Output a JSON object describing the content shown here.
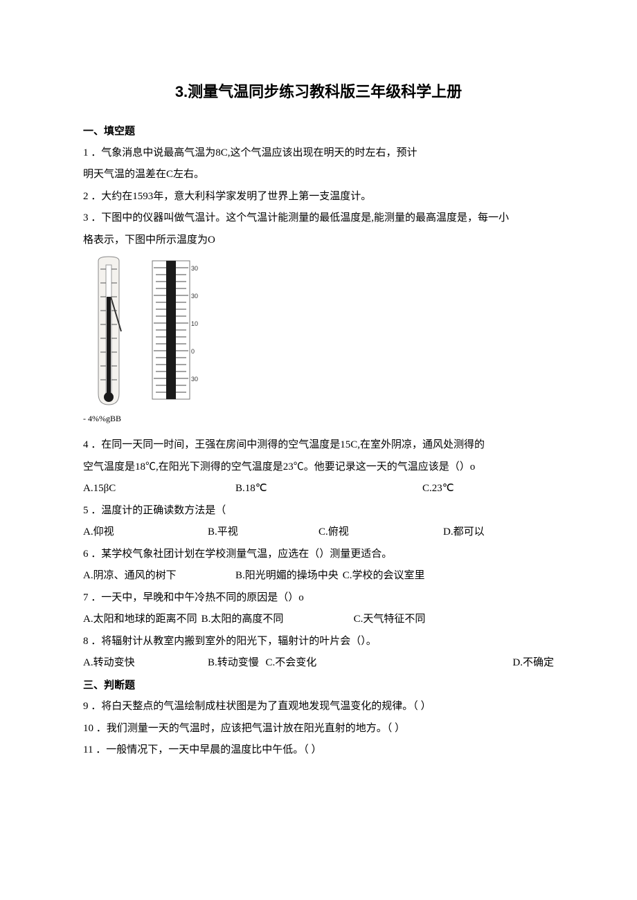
{
  "title": "3.测量气温同步练习教科版三年级科学上册",
  "section1": "一、填空题",
  "q1": "1 ．气象消息中说最高气温为8C,这个气温应该出现在明天的时左右，预计",
  "q1b": "明天气温的温差在C左右。",
  "q2": "2 ．大约在1593年，意大利科学家发明了世界上第一支温度计。",
  "q3a": "3 ．下图中的仪器叫做气温计。这个气温计能测量的最低温度是,能测量的最高温度是，每一小",
  "q3b": "格表示，下图中所示温度为O",
  "figure_caption": "-     4%%gBB",
  "q4a": "4 ．在同一天同一时间，王强在房间中测得的空气温度是15C,在室外阴凉，通风处测得的",
  "q4b": "空气温度是18℃,在阳光下测得的空气温度是23℃。他要记录这一天的气温应该是（）o",
  "q4_optA": "A.15βC",
  "q4_optB": "B.18℃",
  "q4_optC": "C.23℃",
  "q5": "5 ．温度计的正确读数方法是（",
  "q5_optA": "A.仰视",
  "q5_optB": "B.平视",
  "q5_optC": "C.俯视",
  "q5_optD": "D.都可以",
  "q6": "6 ．某学校气象社团计划在学校测量气温，应选在（）测量更适合。",
  "q6_optA": "A.阴凉、通风的树下",
  "q6_optB": "B.阳光明媚的操场中央",
  "q6_optC": "C.学校的会议室里",
  "q7": "7 ．一天中，早晚和中午冷热不同的原因是（）o",
  "q7_optA": "A.太阳和地球的距离不同",
  "q7_optB": "B.太阳的高度不同",
  "q7_optC": "C.天气特征不同",
  "q8": "8 ．将辐射计从教室内搬到室外的阳光下，辐射计的叶片会（）。",
  "q8_optA": "A.转动变快",
  "q8_optB": "B.转动变慢",
  "q8_optC": "C.不会变化",
  "q8_optD": "D.不确定",
  "section3": "三、判断题",
  "q9": "9 ．将白天整点的气温绘制成柱状图是为了直观地发现气温变化的规律。（         ）",
  "q10": "10 ．我们测量一天的气温时，应该把气温计放在阳光直射的地方。（        ）",
  "q11": "11 ．一般情况下，一天中早晨的温度比中午低。（        ）"
}
